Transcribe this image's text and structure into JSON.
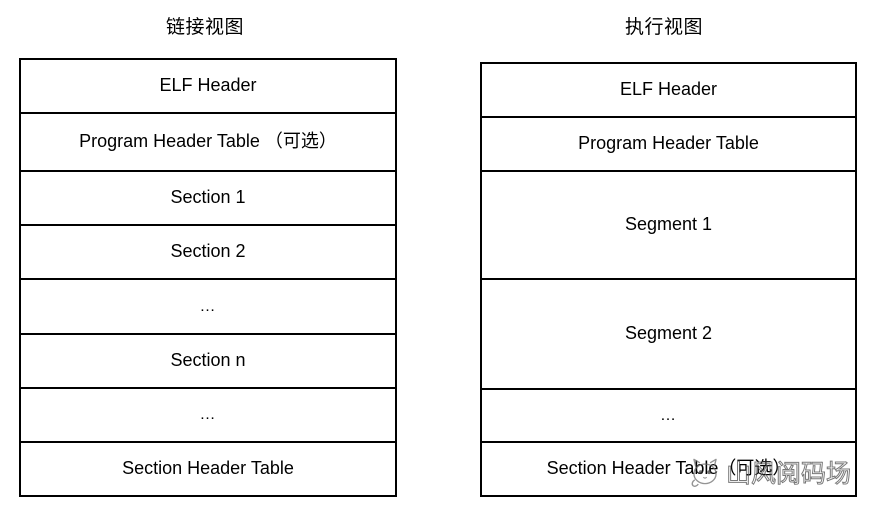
{
  "diagram": {
    "columns": [
      {
        "id": "linking-view",
        "title": "链接视图",
        "rows": [
          {
            "label": "ELF Header",
            "kind": "label"
          },
          {
            "label": "Program Header  Table （可选）",
            "kind": "label"
          },
          {
            "label": "Section 1",
            "kind": "label"
          },
          {
            "label": "Section 2",
            "kind": "label"
          },
          {
            "label": "…",
            "kind": "ellipsis"
          },
          {
            "label": "Section n",
            "kind": "label"
          },
          {
            "label": "…",
            "kind": "ellipsis"
          },
          {
            "label": "Section Header Table",
            "kind": "label"
          }
        ]
      },
      {
        "id": "execution-view",
        "title": "执行视图",
        "rows": [
          {
            "label": "ELF Header",
            "kind": "label"
          },
          {
            "label": "Program Header Table",
            "kind": "label"
          },
          {
            "label": "Segment 1",
            "kind": "label"
          },
          {
            "label": "Segment 2",
            "kind": "label"
          },
          {
            "label": "…",
            "kind": "ellipsis"
          },
          {
            "label": "Section Header Table（可选）",
            "kind": "label"
          }
        ]
      }
    ]
  },
  "watermark": {
    "text": "山风阅码场",
    "logo": "cat-mascot-logo"
  },
  "colors": {
    "border": "#000000",
    "text": "#000000",
    "background": "#ffffff",
    "watermark": "#5a5a5a"
  }
}
